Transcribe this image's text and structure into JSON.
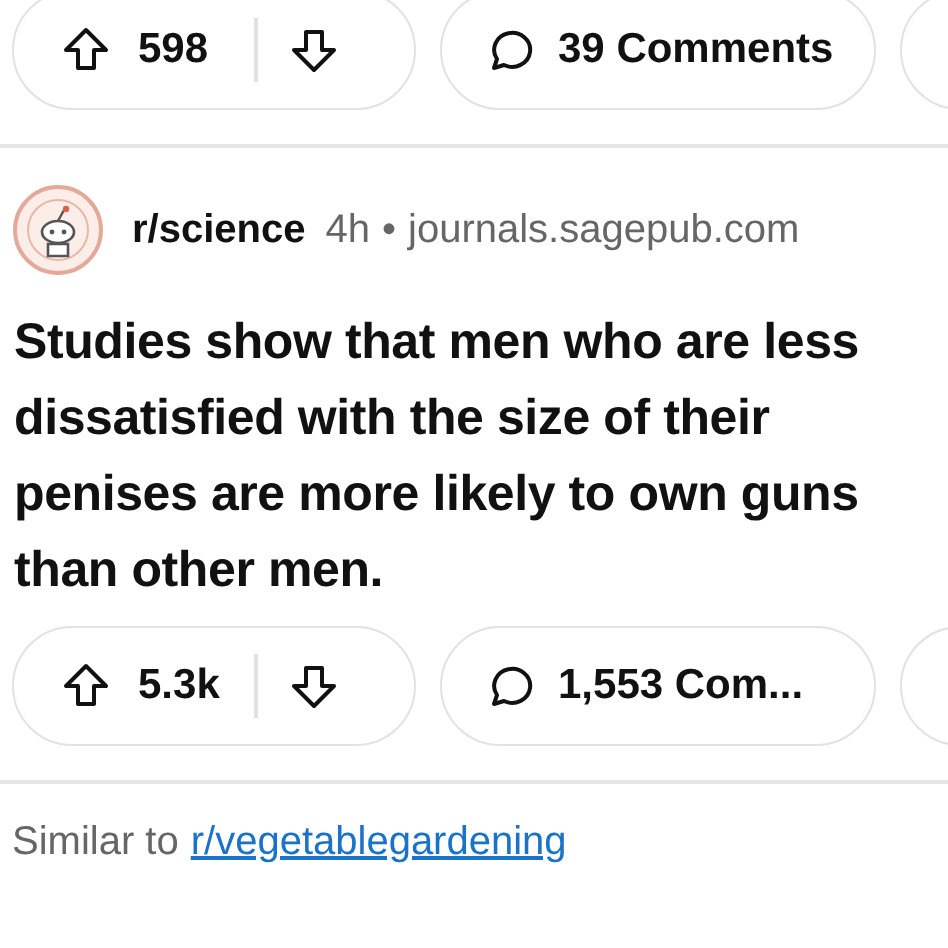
{
  "posts": [
    {
      "actions": {
        "votes": "598",
        "comments": "39 Comments"
      }
    },
    {
      "subreddit": "r/science",
      "age": "4h",
      "separator": "•",
      "domain": "journals.sagepub.com",
      "title": "Studies show that men who are less dissatisfied with the size of their penises are more likely to own guns than other men.",
      "actions": {
        "votes": "5.3k",
        "comments": "1,553 Com..."
      }
    }
  ],
  "recommendation": {
    "text": "Similar to",
    "link": "r/vegetablegardening"
  }
}
